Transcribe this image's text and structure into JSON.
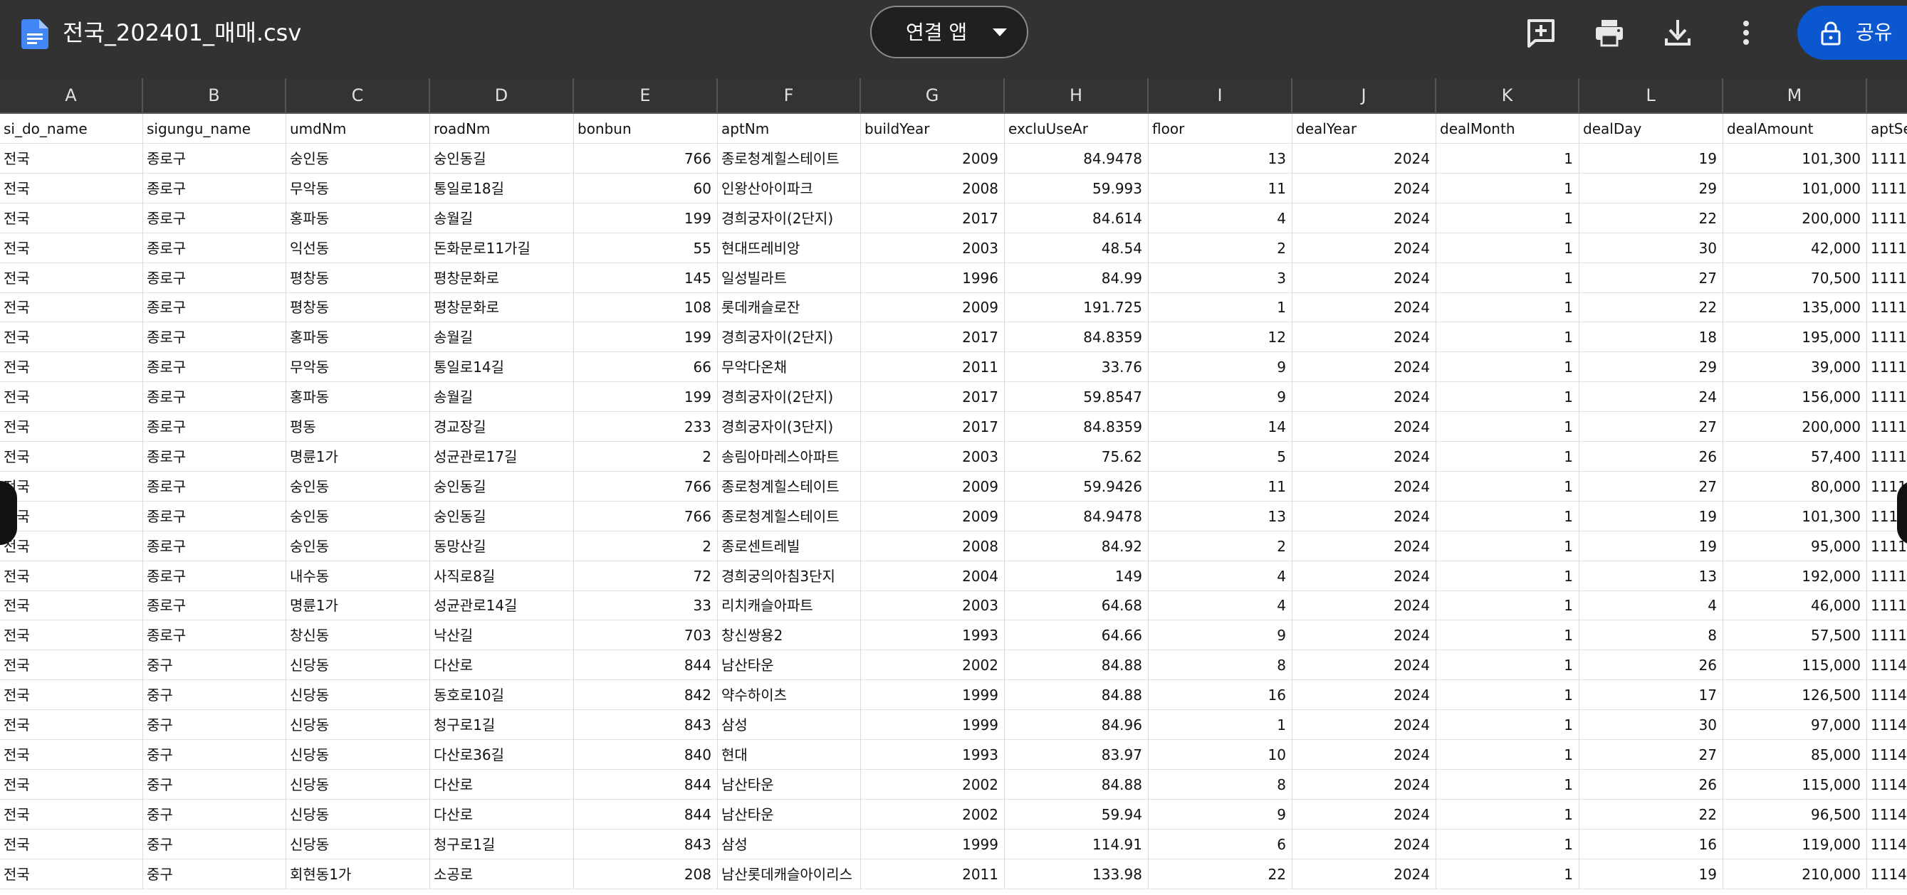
{
  "topbar": {
    "file_title": "전국_202401_매매.csv",
    "open_with_label": "연결 앱",
    "share_label": "공유",
    "colors": {
      "bar": "#323232",
      "share": "#0b57d0",
      "doc_icon": "#4285f4"
    },
    "icons": [
      "doc-icon",
      "add-comment-icon",
      "print-icon",
      "download-icon",
      "more-vert-icon",
      "lock-icon"
    ]
  },
  "sheet": {
    "column_letters": [
      "A",
      "B",
      "C",
      "D",
      "E",
      "F",
      "G",
      "H",
      "I",
      "J",
      "K",
      "L",
      "M",
      ""
    ],
    "headers": [
      "si_do_name",
      "sigungu_name",
      "umdNm",
      "roadNm",
      "bonbun",
      "aptNm",
      "buildYear",
      "excluUseAr",
      "floor",
      "dealYear",
      "dealMonth",
      "dealDay",
      "dealAmount",
      "aptSe"
    ],
    "rows": [
      [
        "전국",
        "종로구",
        "숭인동",
        "숭인동길",
        "766",
        "종로청계힐스테이트",
        "2009",
        "84.9478",
        "13",
        "2024",
        "1",
        "19",
        "101,300",
        "1111"
      ],
      [
        "전국",
        "종로구",
        "무악동",
        "통일로18길",
        "60",
        "인왕산아이파크",
        "2008",
        "59.993",
        "11",
        "2024",
        "1",
        "29",
        "101,000",
        "1111"
      ],
      [
        "전국",
        "종로구",
        "홍파동",
        "송월길",
        "199",
        "경희궁자이(2단지)",
        "2017",
        "84.614",
        "4",
        "2024",
        "1",
        "22",
        "200,000",
        "1111"
      ],
      [
        "전국",
        "종로구",
        "익선동",
        "돈화문로11가길",
        "55",
        "현대뜨레비앙",
        "2003",
        "48.54",
        "2",
        "2024",
        "1",
        "30",
        "42,000",
        "1111"
      ],
      [
        "전국",
        "종로구",
        "평창동",
        "평창문화로",
        "145",
        "일성빌라트",
        "1996",
        "84.99",
        "3",
        "2024",
        "1",
        "27",
        "70,500",
        "1111"
      ],
      [
        "전국",
        "종로구",
        "평창동",
        "평창문화로",
        "108",
        "롯데캐슬로잔",
        "2009",
        "191.725",
        "1",
        "2024",
        "1",
        "22",
        "135,000",
        "1111"
      ],
      [
        "전국",
        "종로구",
        "홍파동",
        "송월길",
        "199",
        "경희궁자이(2단지)",
        "2017",
        "84.8359",
        "12",
        "2024",
        "1",
        "18",
        "195,000",
        "1111"
      ],
      [
        "전국",
        "종로구",
        "무악동",
        "통일로14길",
        "66",
        "무악다온채",
        "2011",
        "33.76",
        "9",
        "2024",
        "1",
        "29",
        "39,000",
        "1111"
      ],
      [
        "전국",
        "종로구",
        "홍파동",
        "송월길",
        "199",
        "경희궁자이(2단지)",
        "2017",
        "59.8547",
        "9",
        "2024",
        "1",
        "24",
        "156,000",
        "1111"
      ],
      [
        "전국",
        "종로구",
        "평동",
        "경교장길",
        "233",
        "경희궁자이(3단지)",
        "2017",
        "84.8359",
        "14",
        "2024",
        "1",
        "27",
        "200,000",
        "1111"
      ],
      [
        "전국",
        "종로구",
        "명륜1가",
        "성균관로17길",
        "2",
        "송림아마레스아파트",
        "2003",
        "75.62",
        "5",
        "2024",
        "1",
        "26",
        "57,400",
        "1111"
      ],
      [
        "전국",
        "종로구",
        "숭인동",
        "숭인동길",
        "766",
        "종로청계힐스테이트",
        "2009",
        "59.9426",
        "11",
        "2024",
        "1",
        "27",
        "80,000",
        "1111"
      ],
      [
        "전국",
        "종로구",
        "숭인동",
        "숭인동길",
        "766",
        "종로청계힐스테이트",
        "2009",
        "84.9478",
        "13",
        "2024",
        "1",
        "19",
        "101,300",
        "1111"
      ],
      [
        "전국",
        "종로구",
        "숭인동",
        "동망산길",
        "2",
        "종로센트레빌",
        "2008",
        "84.92",
        "2",
        "2024",
        "1",
        "19",
        "95,000",
        "1111"
      ],
      [
        "전국",
        "종로구",
        "내수동",
        "사직로8길",
        "72",
        "경희궁의아침3단지",
        "2004",
        "149",
        "4",
        "2024",
        "1",
        "13",
        "192,000",
        "1111"
      ],
      [
        "전국",
        "종로구",
        "명륜1가",
        "성균관로14길",
        "33",
        "리치캐슬아파트",
        "2003",
        "64.68",
        "4",
        "2024",
        "1",
        "4",
        "46,000",
        "1111"
      ],
      [
        "전국",
        "종로구",
        "창신동",
        "낙산길",
        "703",
        "창신쌍용2",
        "1993",
        "64.66",
        "9",
        "2024",
        "1",
        "8",
        "57,500",
        "1111"
      ],
      [
        "전국",
        "중구",
        "신당동",
        "다산로",
        "844",
        "남산타운",
        "2002",
        "84.88",
        "8",
        "2024",
        "1",
        "26",
        "115,000",
        "1114"
      ],
      [
        "전국",
        "중구",
        "신당동",
        "동호로10길",
        "842",
        "약수하이츠",
        "1999",
        "84.88",
        "16",
        "2024",
        "1",
        "17",
        "126,500",
        "1114"
      ],
      [
        "전국",
        "중구",
        "신당동",
        "청구로1길",
        "843",
        "삼성",
        "1999",
        "84.96",
        "1",
        "2024",
        "1",
        "30",
        "97,000",
        "1114"
      ],
      [
        "전국",
        "중구",
        "신당동",
        "다산로36길",
        "840",
        "현대",
        "1993",
        "83.97",
        "10",
        "2024",
        "1",
        "27",
        "85,000",
        "1114"
      ],
      [
        "전국",
        "중구",
        "신당동",
        "다산로",
        "844",
        "남산타운",
        "2002",
        "84.88",
        "8",
        "2024",
        "1",
        "26",
        "115,000",
        "1114"
      ],
      [
        "전국",
        "중구",
        "신당동",
        "다산로",
        "844",
        "남산타운",
        "2002",
        "59.94",
        "9",
        "2024",
        "1",
        "22",
        "96,500",
        "1114"
      ],
      [
        "전국",
        "중구",
        "신당동",
        "청구로1길",
        "843",
        "삼성",
        "1999",
        "114.91",
        "6",
        "2024",
        "1",
        "16",
        "119,000",
        "1114"
      ],
      [
        "전국",
        "중구",
        "회현동1가",
        "소공로",
        "208",
        "남산롯데캐슬아이리스",
        "2011",
        "133.98",
        "22",
        "2024",
        "1",
        "19",
        "210,000",
        "1114"
      ]
    ]
  }
}
